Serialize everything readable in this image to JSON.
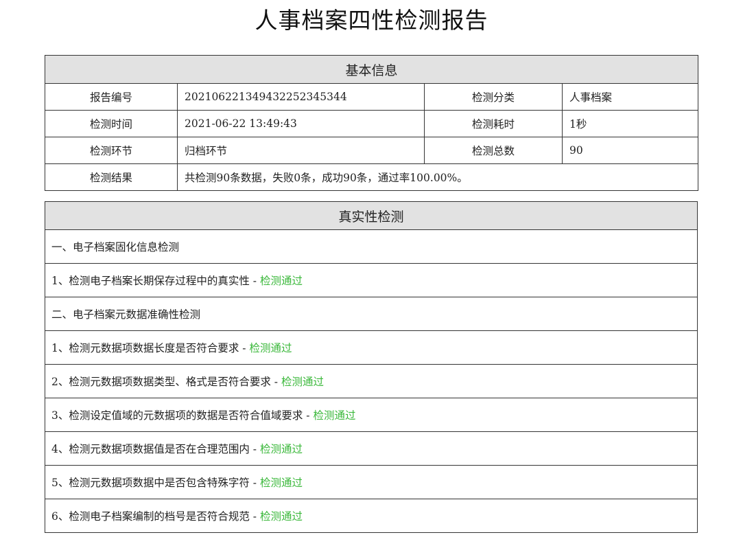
{
  "title": "人事档案四性检测报告",
  "basic_info": {
    "header": "基本信息",
    "rows": [
      {
        "label1": "报告编号",
        "value1": "20210622134943225234534​4",
        "label2": "检测分类",
        "value2": "人事档案"
      },
      {
        "label1": "检测时间",
        "value1": "2021-06-22 13:49:43",
        "label2": "检测耗时",
        "value2": "1秒"
      },
      {
        "label1": "检测环节",
        "value1": "归档环节",
        "label2": "检测总数",
        "value2": "90"
      }
    ],
    "result_label": "检测结果",
    "result_value": "共检测90条数据，失败0条，成功90条，通过率100.00%。"
  },
  "authenticity": {
    "header": "真实性检测",
    "status_color": "#3bb83b",
    "separator": " - ",
    "rows": [
      {
        "text": "一、电子档案固化信息检测",
        "status": ""
      },
      {
        "text": "1、检测电子档案长期保存过程中的真实性",
        "status": "检测通过"
      },
      {
        "text": "二、电子档案元数据准确性检测",
        "status": ""
      },
      {
        "text": "1、检测元数据项数据长度是否符合要求",
        "status": "检测通过"
      },
      {
        "text": "2、检测元数据项数据类型、格式是否符合要求",
        "status": "检测通过"
      },
      {
        "text": "3、检测设定值域的元数据项的数据是否符合值域要求",
        "status": "检测通过"
      },
      {
        "text": "4、检测元数据项数据值是否在合理范围内",
        "status": "检测通过"
      },
      {
        "text": "5、检测元数据项数据中是否包含特殊字符",
        "status": "检测通过"
      },
      {
        "text": "6、检测电子档案编制的档号是否符合规范",
        "status": "检测通过"
      }
    ]
  }
}
